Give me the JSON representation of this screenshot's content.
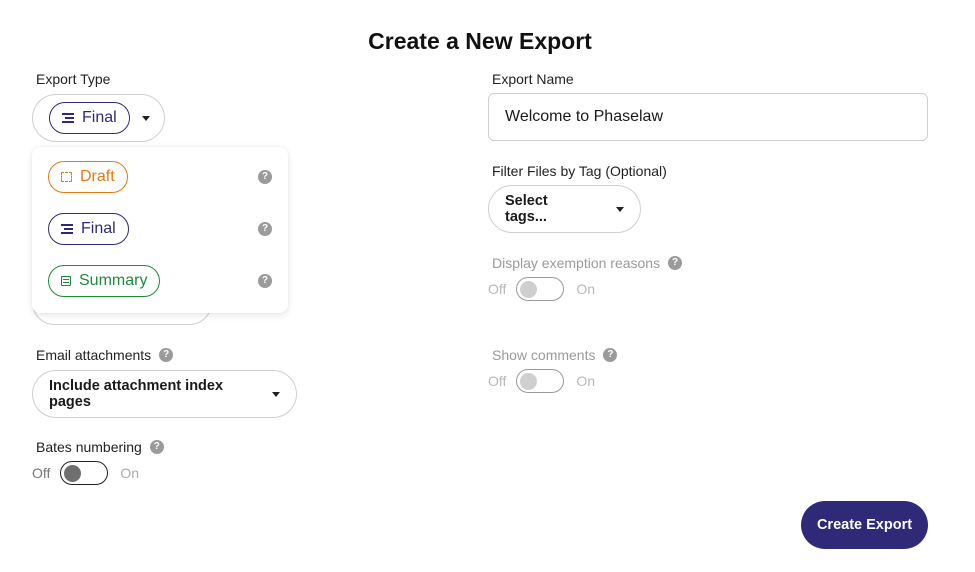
{
  "title": "Create a New Export",
  "export_type": {
    "label": "Export Type",
    "selected": "Final",
    "options": [
      {
        "label": "Draft",
        "icon": "draft-icon",
        "color": "#e07b14"
      },
      {
        "label": "Final",
        "icon": "lines-icon",
        "color": "#2f2a78"
      },
      {
        "label": "Summary",
        "icon": "summary-icon",
        "color": "#1d8a3a"
      }
    ]
  },
  "export_name": {
    "label": "Export Name",
    "value": "Welcome to Phaselaw"
  },
  "filter_tags": {
    "label": "Filter Files by Tag (Optional)",
    "button": "Select tags..."
  },
  "exemption": {
    "label": "Display exemption reasons",
    "off": "Off",
    "on": "On"
  },
  "comments": {
    "label": "Show comments",
    "off": "Off",
    "on": "On"
  },
  "email_attachments": {
    "label": "Email attachments",
    "selected": "Include attachment index pages"
  },
  "bates": {
    "label": "Bates numbering",
    "off": "Off",
    "on": "On"
  },
  "help_glyph": "?",
  "create_button": "Create Export",
  "colors": {
    "primary": "#2f2a78",
    "draft": "#e07b14",
    "summary": "#1d8a3a"
  }
}
